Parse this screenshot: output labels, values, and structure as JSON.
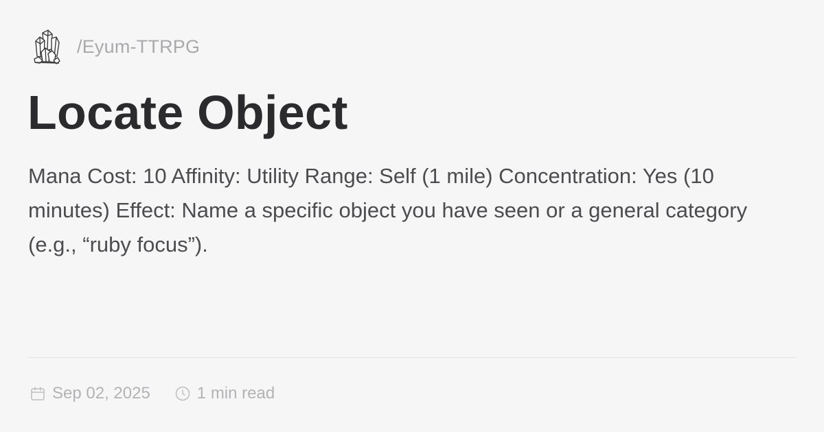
{
  "header": {
    "logo_icon": "crystal-cluster-icon",
    "site_path": "/Eyum-TTRPG"
  },
  "post": {
    "title": "Locate Object",
    "excerpt": "Mana Cost: 10 Affinity: Utility Range: Self (1 mile) Concentration: Yes (10 minutes) Effect: Name a specific object you have seen or a general category (e.g., “ruby focus”)."
  },
  "meta": {
    "date_icon": "calendar-icon",
    "date": "Sep 02, 2025",
    "reading_time_icon": "clock-icon",
    "reading_time": "1 min read"
  },
  "colors": {
    "background": "#f7f6f7",
    "title": "#2b2b2d",
    "body_text": "#4c4c4f",
    "muted_text": "#a9a9ab",
    "divider": "#e4e3e5"
  }
}
